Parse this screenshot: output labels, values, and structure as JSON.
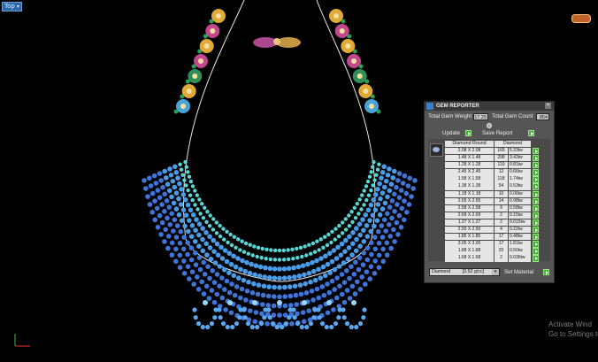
{
  "viewport": {
    "label": "Top",
    "watermark_line1": "Activate Wind",
    "watermark_line2": "Go to Settings to"
  },
  "gem_reporter": {
    "title": "GEM REPORTER",
    "total_weight_label": "Total Gem Weight",
    "total_weight_value": "17.25",
    "total_count_label": "Total Gem Count",
    "total_count_value": "854",
    "update_label": "Update",
    "save_report_label": "Save Report",
    "col_shape": "Diamond Round",
    "col_material": "Diamond",
    "rows": [
      {
        "size": "2.08 X 2.08",
        "count": "165",
        "weight": "5.33tw"
      },
      {
        "size": "1.48 X 1.48",
        "count": "298",
        "weight": "3.42tw"
      },
      {
        "size": "1.28 X 1.28",
        "count": "110",
        "weight": "0.81tw"
      },
      {
        "size": "2.45 X 2.45",
        "count": "12",
        "weight": "0.66tw"
      },
      {
        "size": "1.58 X 1.58",
        "count": "118",
        "weight": "1.74tw"
      },
      {
        "size": "1.38 X 1.38",
        "count": "54",
        "weight": "0.53tw"
      },
      {
        "size": "1.18 X 1.18",
        "count": "10",
        "weight": "0.06tw"
      },
      {
        "size": "2.65 X 2.65",
        "count": "14",
        "weight": "0.98tw"
      },
      {
        "size": "2.58 X 2.58",
        "count": "9",
        "weight": "0.58tw"
      },
      {
        "size": "2.69 X 2.69",
        "count": "2",
        "weight": "0.15tw"
      },
      {
        "size": "1.27 X 1.27",
        "count": "2",
        "weight": "0.015tw"
      },
      {
        "size": "2.50 X 2.50",
        "count": "4",
        "weight": "0.22tw"
      },
      {
        "size": "1.85 X 1.85",
        "count": "17",
        "weight": "0.48tw"
      },
      {
        "size": "3.05 X 3.05",
        "count": "17",
        "weight": "1.81tw"
      },
      {
        "size": "1.88 X 1.88",
        "count": "20",
        "weight": "0.50tw"
      },
      {
        "size": "1.68 X 1.68",
        "count": "2",
        "weight": "0.036tw"
      }
    ],
    "material_select": "Diamond",
    "material_density": "[3.52 g/cc]",
    "set_material_label": "Set Material"
  },
  "colors": {
    "background": "#000000",
    "panel": "#555555",
    "action_green": "#3fae32",
    "viewport_label": "#2c67a8"
  }
}
